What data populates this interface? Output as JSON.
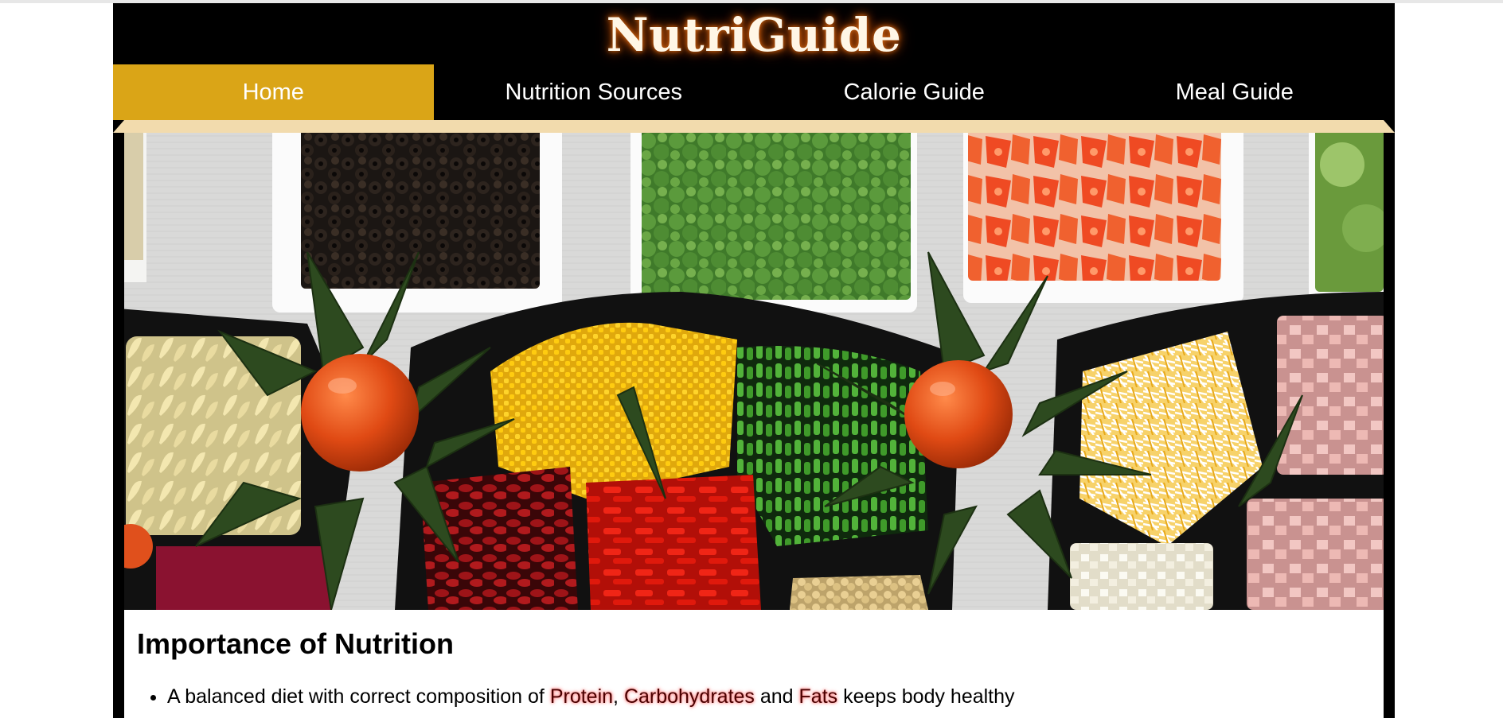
{
  "header": {
    "site_title": "NutriGuide"
  },
  "nav": {
    "items": [
      {
        "label": "Home",
        "active": true
      },
      {
        "label": "Nutrition Sources",
        "active": false
      },
      {
        "label": "Calorie Guide",
        "active": false
      },
      {
        "label": "Meal Guide",
        "active": false
      }
    ]
  },
  "colors": {
    "frame": "#000000",
    "nav_active": "#daa517",
    "nav_underline": "#f2dbad",
    "title_glow": "#d86a12",
    "highlight_glow": "#ff6b6b"
  },
  "hero": {
    "subject": "bowls of chopped vegetables, olives, corn, beans, cheese and ham on a buffet table"
  },
  "main": {
    "heading": "Importance of Nutrition",
    "bullet_1": {
      "prefix": "A balanced diet with correct composition of ",
      "term_1": "Protein",
      "sep_1": ", ",
      "term_2": "Carbohydrates",
      "sep_2": " and ",
      "term_3": "Fats",
      "suffix": " keeps body healthy"
    }
  }
}
